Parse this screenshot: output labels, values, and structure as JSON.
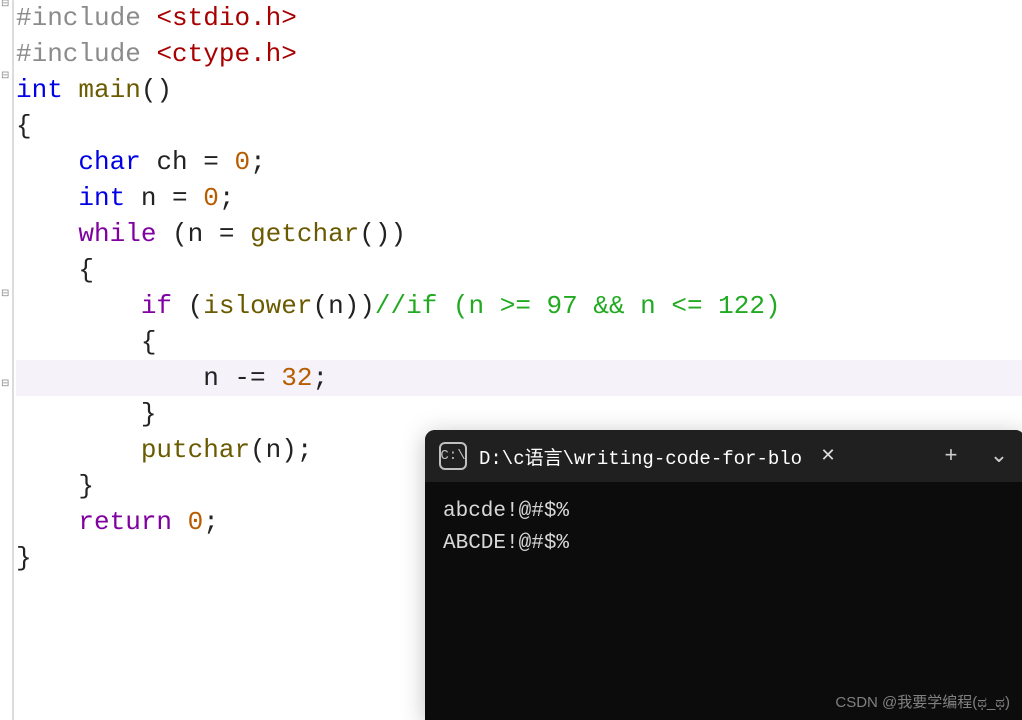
{
  "code": {
    "lines": [
      {
        "segments": [
          {
            "t": "#include ",
            "cls": "kw-preproc"
          },
          {
            "t": "<stdio.h>",
            "cls": "hdr"
          }
        ]
      },
      {
        "segments": [
          {
            "t": "#include ",
            "cls": "kw-preproc"
          },
          {
            "t": "<ctype.h>",
            "cls": "hdr"
          }
        ]
      },
      {
        "segments": [
          {
            "t": "int",
            "cls": "kw-blue"
          },
          {
            "t": " ",
            "cls": "plain"
          },
          {
            "t": "main",
            "cls": "func"
          },
          {
            "t": "()",
            "cls": "plain"
          }
        ]
      },
      {
        "segments": [
          {
            "t": "{",
            "cls": "plain"
          }
        ]
      },
      {
        "segments": [
          {
            "t": "    ",
            "cls": "plain"
          },
          {
            "t": "char",
            "cls": "kw-blue"
          },
          {
            "t": " ch = ",
            "cls": "plain"
          },
          {
            "t": "0",
            "cls": "num"
          },
          {
            "t": ";",
            "cls": "plain"
          }
        ]
      },
      {
        "segments": [
          {
            "t": "    ",
            "cls": "plain"
          },
          {
            "t": "int",
            "cls": "kw-blue"
          },
          {
            "t": " n = ",
            "cls": "plain"
          },
          {
            "t": "0",
            "cls": "num"
          },
          {
            "t": ";",
            "cls": "plain"
          }
        ]
      },
      {
        "segments": [
          {
            "t": "    ",
            "cls": "plain"
          },
          {
            "t": "while",
            "cls": "kw-purple"
          },
          {
            "t": " (n = ",
            "cls": "plain"
          },
          {
            "t": "getchar",
            "cls": "func"
          },
          {
            "t": "())",
            "cls": "plain"
          }
        ]
      },
      {
        "segments": [
          {
            "t": "    {",
            "cls": "plain"
          }
        ]
      },
      {
        "segments": [
          {
            "t": "        ",
            "cls": "plain"
          },
          {
            "t": "if",
            "cls": "kw-purple"
          },
          {
            "t": " (",
            "cls": "plain"
          },
          {
            "t": "islower",
            "cls": "func"
          },
          {
            "t": "(n))",
            "cls": "plain"
          },
          {
            "t": "//if (n >= 97 && n <= 122)",
            "cls": "comment"
          }
        ]
      },
      {
        "segments": [
          {
            "t": "        {",
            "cls": "plain"
          }
        ]
      },
      {
        "hl": true,
        "segments": [
          {
            "t": "            n -= ",
            "cls": "plain"
          },
          {
            "t": "32",
            "cls": "num"
          },
          {
            "t": ";",
            "cls": "plain"
          }
        ]
      },
      {
        "segments": [
          {
            "t": "        }",
            "cls": "plain"
          }
        ]
      },
      {
        "segments": [
          {
            "t": "        ",
            "cls": "plain"
          },
          {
            "t": "putchar",
            "cls": "func"
          },
          {
            "t": "(n);",
            "cls": "plain"
          }
        ]
      },
      {
        "segments": [
          {
            "t": "    }",
            "cls": "plain"
          }
        ]
      },
      {
        "segments": [
          {
            "t": "    ",
            "cls": "plain"
          },
          {
            "t": "return",
            "cls": "kw-purple"
          },
          {
            "t": " ",
            "cls": "plain"
          },
          {
            "t": "0",
            "cls": "num"
          },
          {
            "t": ";",
            "cls": "plain"
          }
        ]
      },
      {
        "segments": [
          {
            "t": "}",
            "cls": "plain"
          }
        ]
      }
    ]
  },
  "terminal": {
    "icon_glyph": "C:\\",
    "title": "D:\\c语言\\writing-code-for-blo",
    "close": "✕",
    "plus": "+",
    "chevron": "⌄",
    "output": [
      "abcde!@#$%",
      "ABCDE!@#$%"
    ]
  },
  "watermark": "CSDN @我要学编程(ಥ_ಥ)",
  "fold_markers": [
    0,
    72,
    290,
    380
  ]
}
